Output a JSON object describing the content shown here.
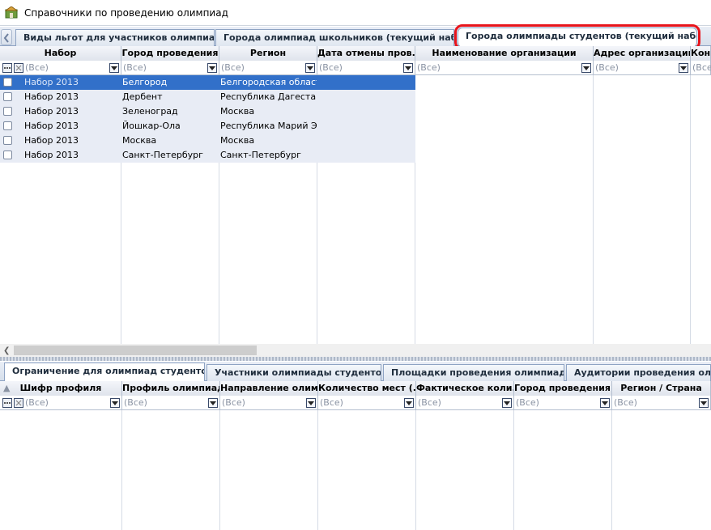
{
  "window": {
    "title": "Справочники по проведению олимпиад"
  },
  "top_tabs": [
    {
      "label": "Виды льгот для участников олимпиад"
    },
    {
      "label": "Города олимпиад школьников (текущий набор)"
    },
    {
      "label": "Города олимпиады студентов (текущий набор)"
    }
  ],
  "top_grid": {
    "columns": [
      "Набор",
      "Город проведения",
      "Регион",
      "Дата отмены пров...",
      "Наименование организации",
      "Адрес организации",
      "Конт"
    ],
    "filter_all": "(Все)",
    "rows": [
      {
        "nabor": "Набор 2013",
        "city": "Белгород",
        "region": "Белгородская область"
      },
      {
        "nabor": "Набор 2013",
        "city": "Дербент",
        "region": "Республика Дагестан"
      },
      {
        "nabor": "Набор 2013",
        "city": "Зеленоград",
        "region": "Москва"
      },
      {
        "nabor": "Набор 2013",
        "city": "Йошкар-Ола",
        "region": "Республика Марий Эл"
      },
      {
        "nabor": "Набор 2013",
        "city": "Москва",
        "region": "Москва"
      },
      {
        "nabor": "Набор 2013",
        "city": "Санкт-Петербург",
        "region": "Санкт-Петербург"
      }
    ]
  },
  "bottom_tabs": [
    {
      "label": "Ограничение для олимпиад студентов"
    },
    {
      "label": "Участники олимпиады студентов"
    },
    {
      "label": "Площадки проведения олимпиады"
    },
    {
      "label": "Аудитории проведения олимп"
    }
  ],
  "bottom_grid": {
    "columns": [
      "Шифр профиля",
      "Профиль олимпиад...",
      "Направление олим...",
      "Количество мест (...",
      "Фактическое коли...",
      "Город проведения...",
      "Регион / Страна"
    ],
    "filter_all": "(Все)"
  },
  "colors": {
    "selection": "#3270c9",
    "highlight_outline": "#e8141b"
  }
}
